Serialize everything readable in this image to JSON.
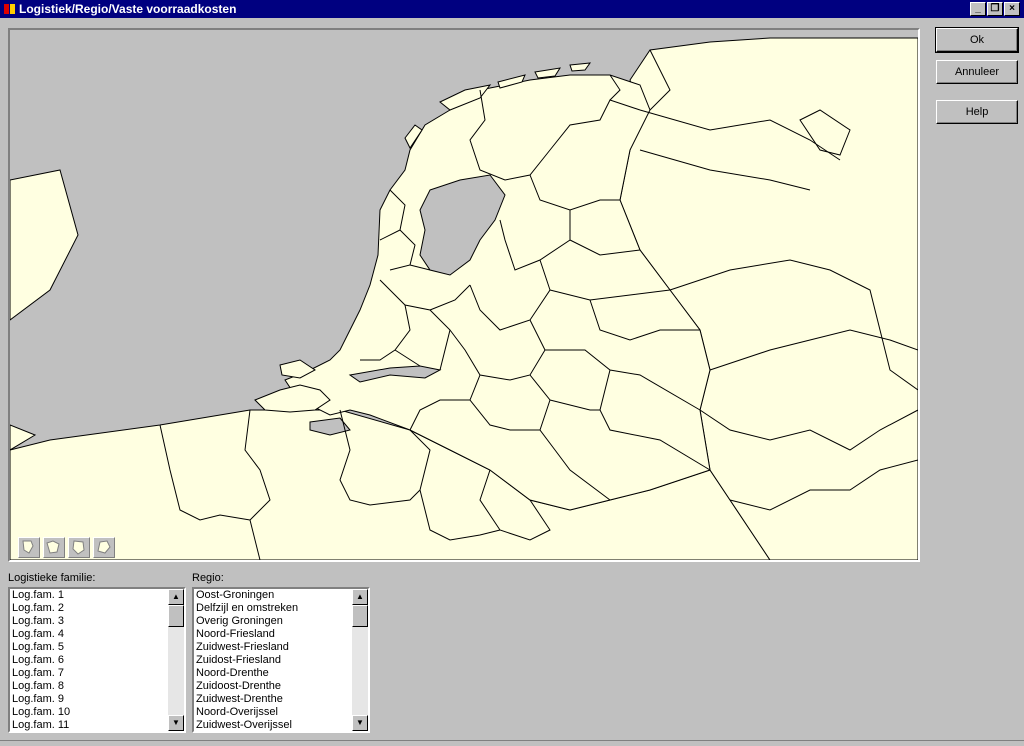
{
  "window": {
    "title": "Logistiek/Regio/Vaste voorraadkosten",
    "controls": [
      "minimize",
      "restore",
      "close"
    ]
  },
  "buttons": {
    "ok": "Ok",
    "cancel": "Annuleer",
    "help": "Help"
  },
  "map_tools": [
    "map-tool-1-icon",
    "map-tool-2-icon",
    "map-tool-3-icon",
    "map-tool-4-icon"
  ],
  "colors": {
    "land": "#ffffe1",
    "sea": "#c0c0c0",
    "border": "#000000",
    "titlebar": "#000080"
  },
  "families": {
    "label": "Logistieke familie:",
    "items": [
      "Log.fam. 1",
      "Log.fam. 2",
      "Log.fam. 3",
      "Log.fam. 4",
      "Log.fam. 5",
      "Log.fam. 6",
      "Log.fam. 7",
      "Log.fam. 8",
      "Log.fam. 9",
      "Log.fam. 10",
      "Log.fam. 11"
    ]
  },
  "regions": {
    "label": "Regio:",
    "items": [
      "Oost-Groningen",
      "Delfzijl en omstreken",
      "Overig Groningen",
      "Noord-Friesland",
      "Zuidwest-Friesland",
      "Zuidost-Friesland",
      "Noord-Drenthe",
      "Zuidoost-Drenthe",
      "Zuidwest-Drenthe",
      "Noord-Overijssel",
      "Zuidwest-Overijssel"
    ]
  }
}
